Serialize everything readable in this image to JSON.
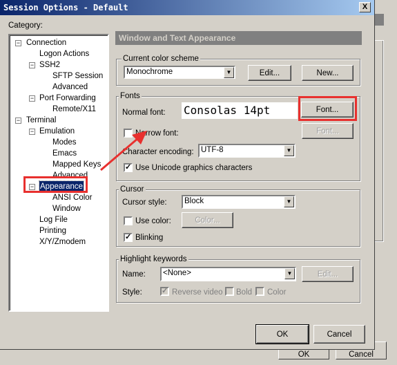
{
  "window": {
    "title": "Session Options - Default",
    "close": "X"
  },
  "category_label": "Category:",
  "tree": [
    {
      "label": "Connection",
      "level": 0,
      "toggle": "−"
    },
    {
      "label": "Logon Actions",
      "level": 1
    },
    {
      "label": "SSH2",
      "level": 1,
      "toggle": "−"
    },
    {
      "label": "SFTP Session",
      "level": 2
    },
    {
      "label": "Advanced",
      "level": 2
    },
    {
      "label": "Port Forwarding",
      "level": 1,
      "toggle": "−"
    },
    {
      "label": "Remote/X11",
      "level": 2
    },
    {
      "label": "Terminal",
      "level": 0,
      "toggle": "−"
    },
    {
      "label": "Emulation",
      "level": 1,
      "toggle": "−"
    },
    {
      "label": "Modes",
      "level": 2
    },
    {
      "label": "Emacs",
      "level": 2
    },
    {
      "label": "Mapped Keys",
      "level": 2
    },
    {
      "label": "Advanced",
      "level": 2
    },
    {
      "label": "Appearance",
      "level": 1,
      "toggle": "−",
      "selected": true
    },
    {
      "label": "ANSI Color",
      "level": 2
    },
    {
      "label": "Window",
      "level": 2
    },
    {
      "label": "Log File",
      "level": 1
    },
    {
      "label": "Printing",
      "level": 1
    },
    {
      "label": "X/Y/Zmodem",
      "level": 1
    }
  ],
  "panel": {
    "header": "Window and Text Appearance",
    "color_scheme": {
      "label": "Current color scheme",
      "value": "Monochrome",
      "edit": "Edit...",
      "new": "New..."
    },
    "fonts": {
      "label": "Fonts",
      "normal_font_label": "Normal font:",
      "normal_font_value": "Consolas 14pt",
      "font_button": "Font...",
      "narrow_font_label": "Narrow font:",
      "narrow_font_checked": false,
      "narrow_font_button": "Font...",
      "encoding_label": "Character encoding:",
      "encoding_value": "UTF-8",
      "unicode_label": "Use Unicode graphics characters",
      "unicode_checked": true
    },
    "cursor": {
      "label": "Cursor",
      "style_label": "Cursor style:",
      "style_value": "Block",
      "use_color_label": "Use color:",
      "use_color_checked": false,
      "color_button": "Color...",
      "blinking_label": "Blinking",
      "blinking_checked": true
    },
    "highlight": {
      "label": "Highlight keywords",
      "name_label": "Name:",
      "name_value": "<None>",
      "edit": "Edit...",
      "style_label": "Style:",
      "reverse_label": "Reverse video",
      "bold_label": "Bold",
      "color_label": "Color"
    }
  },
  "buttons": {
    "ok": "OK",
    "cancel": "Cancel"
  },
  "background_buttons": {
    "ok": "OK",
    "cancel": "Cancel"
  },
  "annotation_color": "#e8302e"
}
